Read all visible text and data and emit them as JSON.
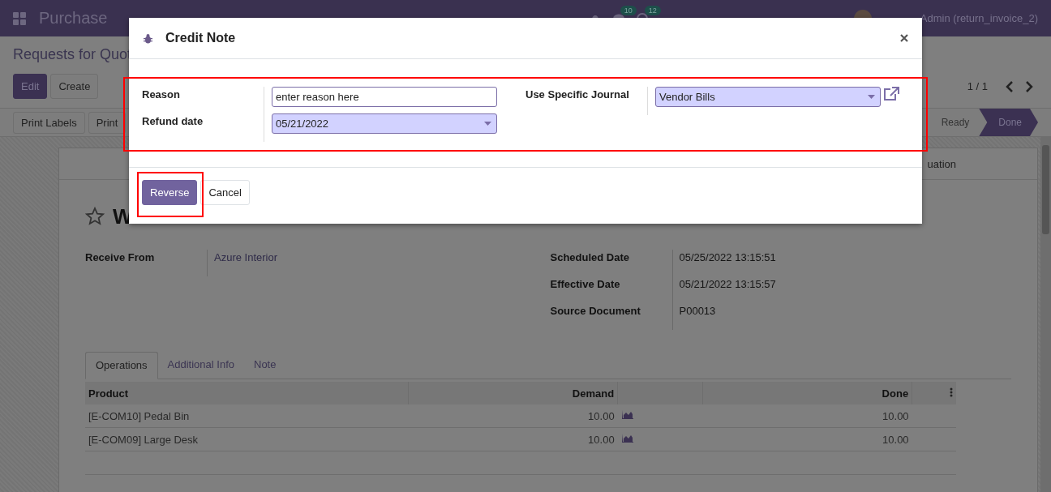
{
  "navbar": {
    "app_name": "Purchase",
    "badges": [
      {
        "kind": "chat",
        "count": "10"
      },
      {
        "kind": "activity",
        "count": "12"
      }
    ],
    "user": "Admin (return_invoice_2)"
  },
  "control_panel": {
    "breadcrumb": "Requests for Quot",
    "buttons": [
      {
        "label": "Edit",
        "kind": "primary"
      },
      {
        "label": "Create",
        "kind": "secondary"
      }
    ],
    "pager": "1 / 1"
  },
  "status_bar": {
    "buttons": [
      "Print Labels",
      "Print"
    ],
    "stages": [
      {
        "label": "Ready",
        "selected": false
      },
      {
        "label": "Done",
        "selected": true
      }
    ]
  },
  "sheet": {
    "smart_button": "uation",
    "starred": false,
    "title": "W",
    "left_fields": [
      {
        "label": "Receive From",
        "value": "Azure Interior"
      }
    ],
    "right_fields": [
      {
        "label": "Scheduled Date",
        "value": "05/25/2022 13:15:51"
      },
      {
        "label": "Effective Date",
        "value": "05/21/2022 13:15:57"
      },
      {
        "label": "Source Document",
        "value": "P00013"
      }
    ],
    "tabs": [
      {
        "label": "Operations",
        "selected": true
      },
      {
        "label": "Additional Info",
        "selected": false
      },
      {
        "label": "Note",
        "selected": false
      }
    ],
    "table": {
      "columns": [
        "Product",
        "Demand",
        "Done"
      ],
      "rows": [
        {
          "product": "[E-COM10] Pedal Bin",
          "demand": "10.00",
          "done": "10.00"
        },
        {
          "product": "[E-COM09] Large Desk",
          "demand": "10.00",
          "done": "10.00"
        }
      ]
    }
  },
  "dialog": {
    "title": "Credit Note",
    "left_fields": [
      {
        "label": "Reason",
        "kind": "text",
        "value": "enter reason here"
      },
      {
        "label": "Refund date",
        "kind": "date",
        "value": "05/21/2022"
      }
    ],
    "right_fields": [
      {
        "label": "Use Specific Journal",
        "kind": "select",
        "value": "Vendor Bills"
      }
    ],
    "buttons": [
      {
        "label": "Reverse",
        "kind": "primary"
      },
      {
        "label": "Cancel",
        "kind": "secondary"
      }
    ]
  }
}
